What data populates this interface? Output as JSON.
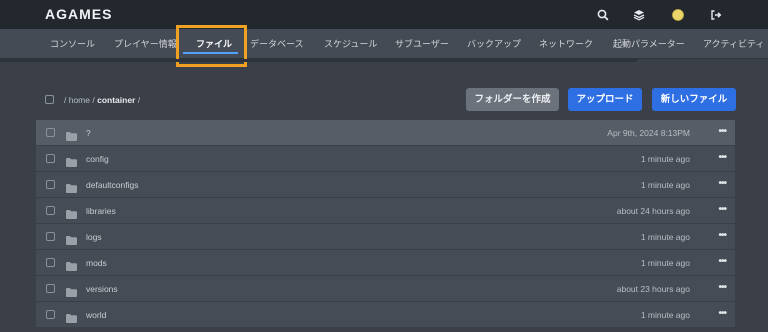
{
  "app": {
    "brand": "AGAMES"
  },
  "topbar_icons": [
    "search-icon",
    "layers-icon",
    "avatar",
    "logout-icon"
  ],
  "tabs": [
    {
      "label": "コンソール"
    },
    {
      "label": "プレイヤー情報"
    },
    {
      "label": "ファイル"
    },
    {
      "label": "データベース"
    },
    {
      "label": "スケジュール"
    },
    {
      "label": "サブユーザー"
    },
    {
      "label": "バックアップ"
    },
    {
      "label": "ネットワーク"
    },
    {
      "label": "起動パラメーター"
    },
    {
      "label": "アクティビティ"
    }
  ],
  "breadcrumb": {
    "prefix": "/ home /",
    "current": "container",
    "suffix": "/"
  },
  "actions": {
    "create_folder": "フォルダーを作成",
    "upload": "アップロード",
    "new_file": "新しいファイル"
  },
  "files": [
    {
      "name": "?",
      "modified": "Apr 9th, 2024 8:13PM"
    },
    {
      "name": "config",
      "modified": "1 minute ago"
    },
    {
      "name": "defaultconfigs",
      "modified": "1 minute ago"
    },
    {
      "name": "libraries",
      "modified": "about 24 hours ago"
    },
    {
      "name": "logs",
      "modified": "1 minute ago"
    },
    {
      "name": "mods",
      "modified": "1 minute ago"
    },
    {
      "name": "versions",
      "modified": "about 23 hours ago"
    },
    {
      "name": "world",
      "modified": "1 minute ago"
    }
  ],
  "more_glyph": "•••",
  "colors": {
    "accent": "#2f6fe4",
    "highlight": "#f0a023",
    "active_tab_underline": "#4fa3ff"
  }
}
